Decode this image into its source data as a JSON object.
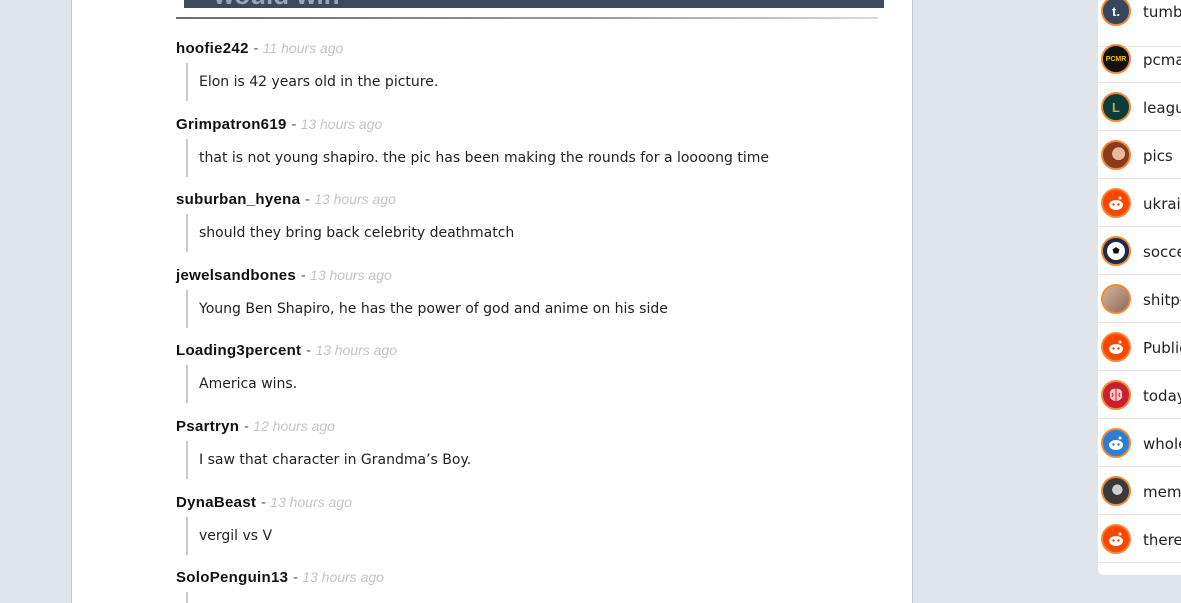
{
  "post": {
    "image_caption_fragment": "would win"
  },
  "comments": [
    {
      "author": "hoofie242",
      "time": "11 hours ago",
      "body": "Elon is 42 years old in the picture."
    },
    {
      "author": "Grimpatron619",
      "time": "13 hours ago",
      "body": "that is not young shapiro. the pic has been making the rounds for a loooong time"
    },
    {
      "author": "suburban_hyena",
      "time": "13 hours ago",
      "body": "should they bring back celebrity deathmatch"
    },
    {
      "author": "jewelsandbones",
      "time": "13 hours ago",
      "body": "Young Ben Shapiro, he has the power of god and anime on his side"
    },
    {
      "author": "Loading3percent",
      "time": "13 hours ago",
      "body": "America wins."
    },
    {
      "author": "Psartryn",
      "time": "12 hours ago",
      "body": "I saw that character in Grandma’s Boy."
    },
    {
      "author": "DynaBeast",
      "time": "13 hours ago",
      "body": "vergil vs V"
    },
    {
      "author": "SoloPenguin13",
      "time": "13 hours ago",
      "body": ""
    }
  ],
  "separator": "-",
  "sidebar": {
    "items": [
      {
        "label": "tumb",
        "icon": "tumblr-icon",
        "icon_glyph": "t.",
        "color": "#36465d"
      },
      {
        "label": "pcma",
        "icon": "pcmr-icon",
        "icon_glyph": "PCMR",
        "color": "#111111"
      },
      {
        "label": "leagu",
        "icon": "league-of-legends-icon",
        "icon_glyph": "L",
        "color": "#0a3d3a"
      },
      {
        "label": "pics",
        "icon": "pics-avatar-icon",
        "icon_glyph": "",
        "color": "#8b3a1e"
      },
      {
        "label": "ukrai",
        "icon": "reddit-alien-icon",
        "icon_glyph": "",
        "color": "#ff4500"
      },
      {
        "label": "socce",
        "icon": "soccer-ball-icon",
        "icon_glyph": "",
        "color": "#1b2a4a"
      },
      {
        "label": "shitpo",
        "icon": "shitpost-avatar-icon",
        "icon_glyph": "",
        "color": "#b08a74"
      },
      {
        "label": "Public",
        "icon": "reddit-alien-icon",
        "icon_glyph": "",
        "color": "#ff4500"
      },
      {
        "label": "today",
        "icon": "brain-icon",
        "icon_glyph": "",
        "color": "#c8202f"
      },
      {
        "label": "whole",
        "icon": "reddit-alien-icon",
        "icon_glyph": "",
        "color": "#2d7fd3"
      },
      {
        "label": "meme",
        "icon": "meme-avatar-icon",
        "icon_glyph": "",
        "color": "#3a3a3a"
      },
      {
        "label": "there",
        "icon": "reddit-alien-icon",
        "icon_glyph": "",
        "color": "#ff4500"
      }
    ]
  }
}
